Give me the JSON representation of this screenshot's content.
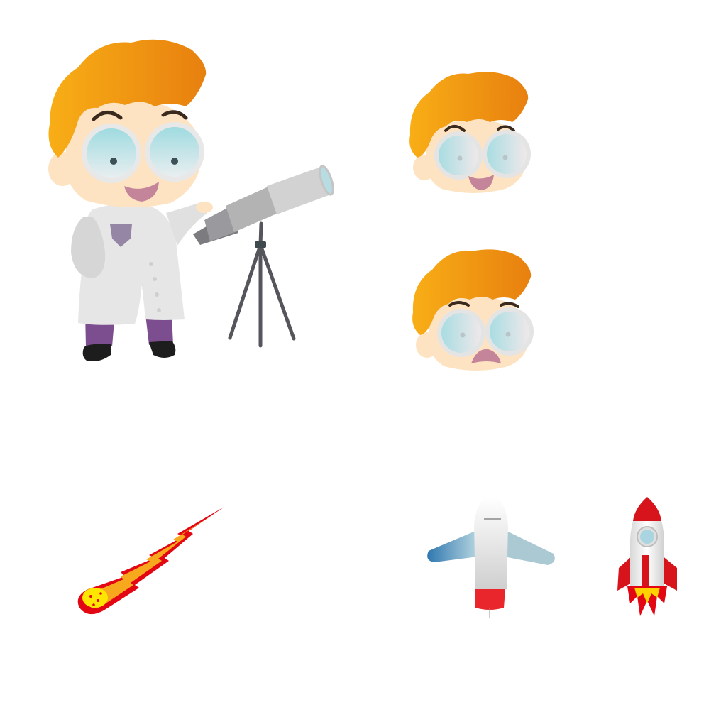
{
  "illustration": {
    "items": [
      {
        "name": "scientist-kid-with-telescope"
      },
      {
        "name": "happy-face"
      },
      {
        "name": "sad-face"
      },
      {
        "name": "meteor"
      },
      {
        "name": "airplane"
      },
      {
        "name": "rocket"
      }
    ],
    "colors": {
      "hair_light": "#f6a51a",
      "hair_dark": "#e8800f",
      "skin": "#fde3c1",
      "lens": "#a9dfe4",
      "coat": "#e6e6e6",
      "pants": "#7d4e8f",
      "shoes": "#1d1d1d",
      "telescope": "#c9c9c9",
      "tripod": "#55555c",
      "rocket_red": "#d7141b",
      "meteor_orange": "#f39a1e",
      "meteor_yellow": "#ffe600",
      "plane_blue": "#3d86b8"
    }
  }
}
